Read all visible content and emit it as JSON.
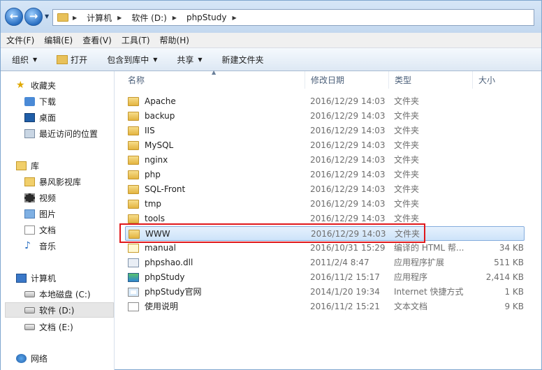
{
  "address_bar": {
    "breadcrumbs": [
      "计算机",
      "软件 (D:)",
      "phpStudy"
    ]
  },
  "menu": [
    "文件(F)",
    "编辑(E)",
    "查看(V)",
    "工具(T)",
    "帮助(H)"
  ],
  "toolbar": {
    "organize": "组织",
    "open": "打开",
    "include_in_library": "包含到库中",
    "share": "共享",
    "new_folder": "新建文件夹"
  },
  "nav": {
    "favorites": "收藏夹",
    "downloads": "下载",
    "desktop": "桌面",
    "recent": "最近访问的位置",
    "libraries": "库",
    "storm": "暴风影视库",
    "videos": "视频",
    "pictures": "图片",
    "documents": "文档",
    "music": "音乐",
    "computer": "计算机",
    "drive_c": "本地磁盘 (C:)",
    "drive_d": "软件 (D:)",
    "drive_e": "文档 (E:)",
    "network": "网络"
  },
  "columns": {
    "name": "名称",
    "date": "修改日期",
    "type": "类型",
    "size": "大小"
  },
  "files": [
    {
      "name": "Apache",
      "date": "2016/12/29 14:03",
      "type": "文件夹",
      "size": "",
      "icon": "folder-icon"
    },
    {
      "name": "backup",
      "date": "2016/12/29 14:03",
      "type": "文件夹",
      "size": "",
      "icon": "folder-icon"
    },
    {
      "name": "IIS",
      "date": "2016/12/29 14:03",
      "type": "文件夹",
      "size": "",
      "icon": "folder-icon"
    },
    {
      "name": "MySQL",
      "date": "2016/12/29 14:03",
      "type": "文件夹",
      "size": "",
      "icon": "folder-icon"
    },
    {
      "name": "nginx",
      "date": "2016/12/29 14:03",
      "type": "文件夹",
      "size": "",
      "icon": "folder-icon"
    },
    {
      "name": "php",
      "date": "2016/12/29 14:03",
      "type": "文件夹",
      "size": "",
      "icon": "folder-icon"
    },
    {
      "name": "SQL-Front",
      "date": "2016/12/29 14:03",
      "type": "文件夹",
      "size": "",
      "icon": "folder-icon"
    },
    {
      "name": "tmp",
      "date": "2016/12/29 14:03",
      "type": "文件夹",
      "size": "",
      "icon": "folder-icon"
    },
    {
      "name": "tools",
      "date": "2016/12/29 14:03",
      "type": "文件夹",
      "size": "",
      "icon": "folder-icon"
    },
    {
      "name": "WWW",
      "date": "2016/12/29 14:03",
      "type": "文件夹",
      "size": "",
      "icon": "folder-icon"
    },
    {
      "name": "manual",
      "date": "2016/10/31 15:29",
      "type": "编译的 HTML 帮...",
      "size": "34 KB",
      "icon": "help-file-icon"
    },
    {
      "name": "phpshao.dll",
      "date": "2011/2/4 8:47",
      "type": "应用程序扩展",
      "size": "511 KB",
      "icon": "dll-file-icon"
    },
    {
      "name": "phpStudy",
      "date": "2016/11/2 15:17",
      "type": "应用程序",
      "size": "2,414 KB",
      "icon": "app-icon"
    },
    {
      "name": "phpStudy官网",
      "date": "2014/1/20 19:34",
      "type": "Internet 快捷方式",
      "size": "1 KB",
      "icon": "internet-shortcut-icon"
    },
    {
      "name": "使用说明",
      "date": "2016/11/2 15:21",
      "type": "文本文档",
      "size": "9 KB",
      "icon": "text-file-icon"
    }
  ],
  "selected_file": "WWW"
}
